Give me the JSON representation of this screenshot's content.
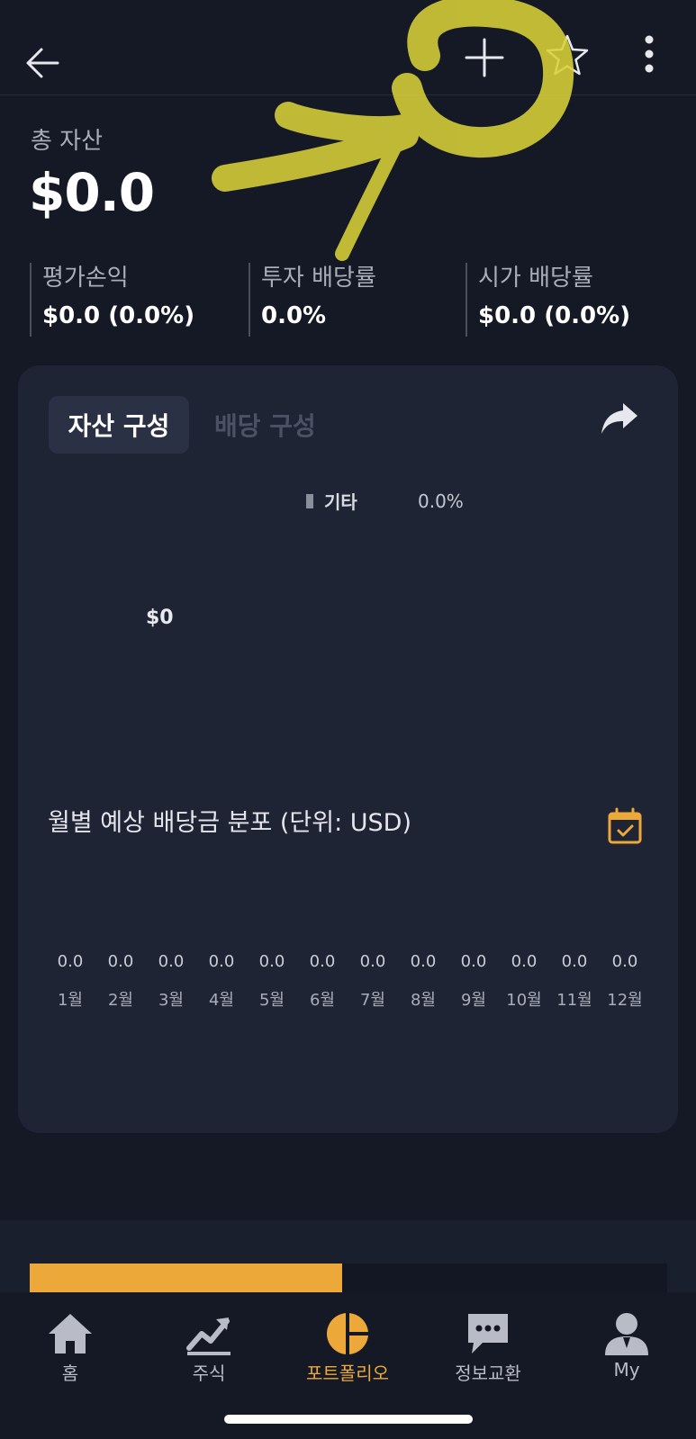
{
  "header": {
    "back_icon": "arrow-left-icon",
    "add_icon": "plus-icon",
    "favorite_icon": "star-icon",
    "more_icon": "more-vertical-icon"
  },
  "summary": {
    "total_label": "총 자산",
    "total_value": "$0.0",
    "stats": [
      {
        "label": "평가손익",
        "value": "$0.0 (0.0%)"
      },
      {
        "label": "투자 배당률",
        "value": "0.0%"
      },
      {
        "label": "시가 배당률",
        "value": "$0.0 (0.0%)"
      }
    ]
  },
  "composition_card": {
    "tabs": [
      {
        "label": "자산 구성",
        "active": true
      },
      {
        "label": "배당 구성",
        "active": false
      }
    ],
    "share_icon": "share-icon",
    "legend": [
      {
        "name": "기타",
        "percent": "0.0%",
        "color": "#8a8f9c"
      }
    ],
    "donut_value": "$0"
  },
  "monthly_dividend": {
    "title": "월별 예상 배당금 분포 (단위: USD)",
    "calendar_icon": "calendar-check-icon"
  },
  "chart_data": {
    "type": "bar",
    "categories": [
      "1월",
      "2월",
      "3월",
      "4월",
      "5월",
      "6월",
      "7월",
      "8월",
      "9월",
      "10월",
      "11월",
      "12월"
    ],
    "values": [
      "0.0",
      "0.0",
      "0.0",
      "0.0",
      "0.0",
      "0.0",
      "0.0",
      "0.0",
      "0.0",
      "0.0",
      "0.0",
      "0.0"
    ],
    "title": "월별 예상 배당금 분포 (단위: USD)"
  },
  "progress": {
    "fraction": 0.49,
    "color": "#eca838"
  },
  "colors": {
    "background": "#151926",
    "card": "#1f2434",
    "accent": "#eca838",
    "scribble": "#d8d038"
  },
  "tabbar": {
    "items": [
      {
        "label": "홈",
        "icon": "home-icon",
        "active": false
      },
      {
        "label": "주식",
        "icon": "stock-chart-icon",
        "active": false
      },
      {
        "label": "포트폴리오",
        "icon": "portfolio-pie-icon",
        "active": true
      },
      {
        "label": "정보교환",
        "icon": "chat-bubble-icon",
        "active": false
      },
      {
        "label": "My",
        "icon": "user-icon",
        "active": false
      }
    ]
  }
}
